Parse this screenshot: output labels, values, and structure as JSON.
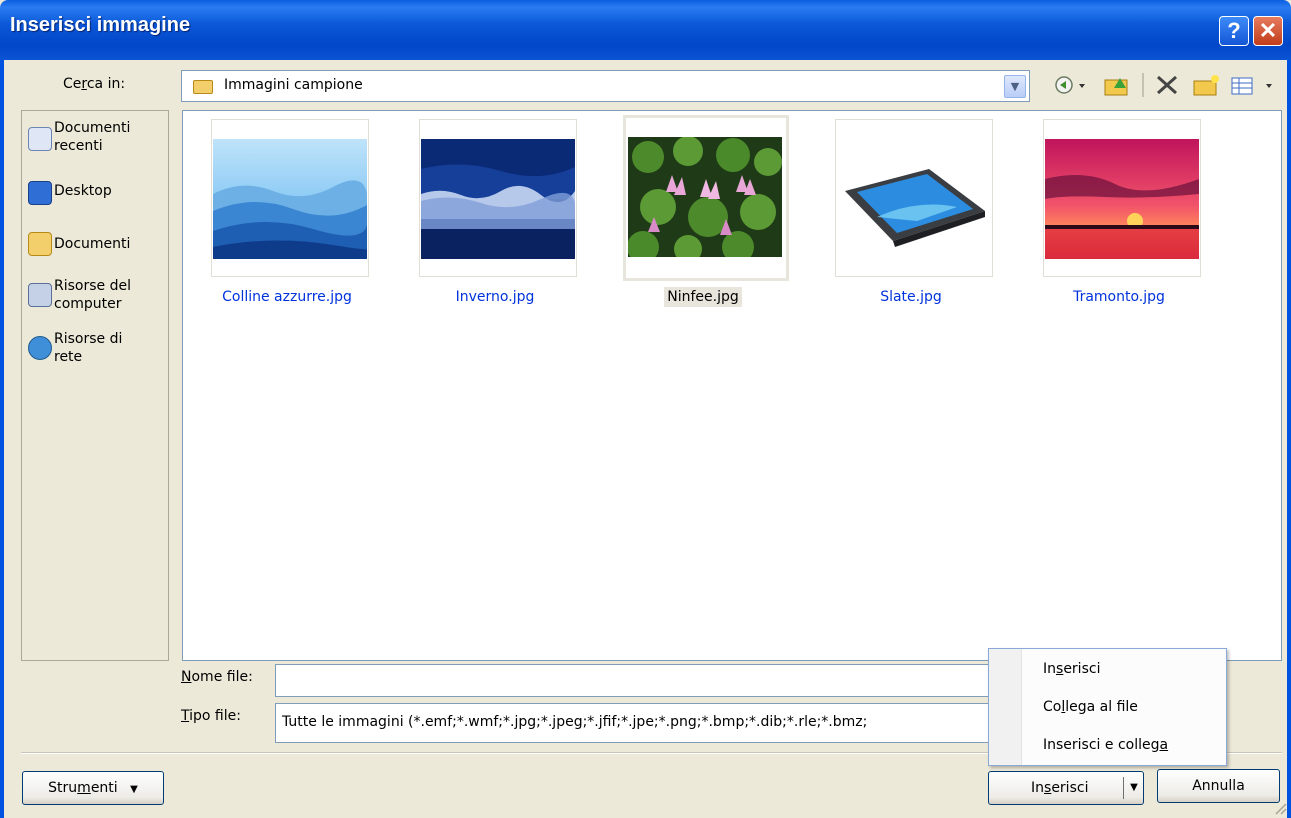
{
  "window": {
    "title": "Inserisci immagine",
    "help_glyph": "?",
    "close_glyph": "✕"
  },
  "lookin": {
    "label_pre": "Ce",
    "label_key": "r",
    "label_post": "ca in:",
    "value": "Immagini campione"
  },
  "places": [
    {
      "label": "Documenti recenti",
      "icon": "recent-documents-icon"
    },
    {
      "label": "Desktop",
      "icon": "desktop-icon"
    },
    {
      "label": "Documenti",
      "icon": "documents-icon"
    },
    {
      "label": "Risorse del computer",
      "icon": "my-computer-icon"
    },
    {
      "label": "Risorse di rete",
      "icon": "network-icon"
    }
  ],
  "files": [
    {
      "name": "Colline azzurre.jpg",
      "selected": false
    },
    {
      "name": "Inverno.jpg",
      "selected": false
    },
    {
      "name": "Ninfee.jpg",
      "selected": true
    },
    {
      "name": "Slate.jpg",
      "selected": false
    },
    {
      "name": "Tramonto.jpg",
      "selected": false
    }
  ],
  "filename": {
    "label_key": "N",
    "label_post": "ome file:",
    "value": ""
  },
  "filetype": {
    "label_key": "T",
    "label_post": "ipo file:",
    "value": "Tutte le immagini (*.emf;*.wmf;*.jpg;*.jpeg;*.jfif;*.jpe;*.png;*.bmp;*.dib;*.rle;*.bmz;"
  },
  "buttons": {
    "tools_pre": "Stru",
    "tools_key": "m",
    "tools_post": "enti",
    "insert_pre": "In",
    "insert_key": "s",
    "insert_post": "erisci",
    "cancel": "Annulla"
  },
  "insert_menu": [
    {
      "pre": "In",
      "key": "s",
      "post": "erisci"
    },
    {
      "pre": "Co",
      "key": "l",
      "post": "lega al file"
    },
    {
      "pre": "Inserisci e colleg",
      "key": "a",
      "post": ""
    }
  ],
  "colors": {
    "title_bar": "#0054e3",
    "link_text": "#0033dd",
    "selection": "#e7e5dc"
  }
}
